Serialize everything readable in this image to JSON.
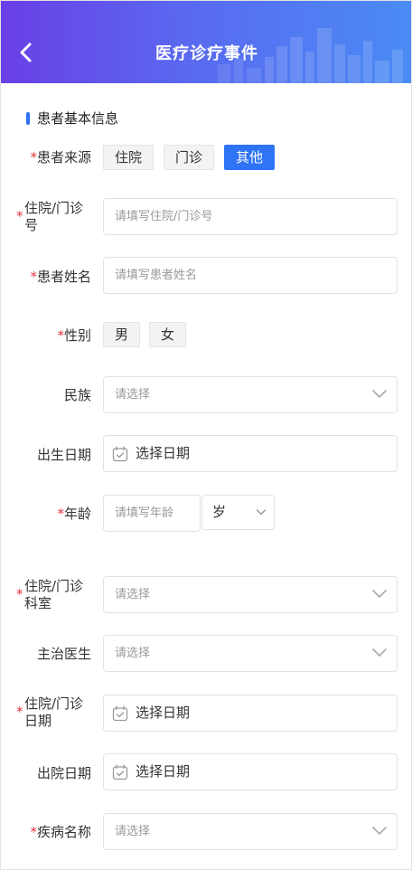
{
  "header": {
    "title": "医疗诊疗事件",
    "back_icon": "chevron-left-icon"
  },
  "section": {
    "title": "患者基本信息"
  },
  "colors": {
    "accent": "#2f73f6",
    "required": "#e0363f",
    "header_start": "#6a3fe6",
    "header_end": "#4a8cf5"
  },
  "form": {
    "source": {
      "label": "患者来源",
      "options": [
        "住院",
        "门诊",
        "其他"
      ],
      "selected": "其他"
    },
    "record_no": {
      "label": "住院/门诊号",
      "placeholder": "请填写住院/门诊号"
    },
    "name": {
      "label": "患者姓名",
      "placeholder": "请填写患者姓名"
    },
    "gender": {
      "label": "性别",
      "options": [
        "男",
        "女"
      ]
    },
    "ethnicity": {
      "label": "民族",
      "placeholder": "请选择"
    },
    "birth_date": {
      "label": "出生日期",
      "value": "选择日期"
    },
    "age": {
      "label": "年龄",
      "placeholder": "请填写年龄",
      "unit": "岁"
    },
    "department": {
      "label": "住院/门诊科室",
      "placeholder": "请选择"
    },
    "doctor": {
      "label": "主治医生",
      "placeholder": "请选择"
    },
    "admission_date": {
      "label": "住院/门诊日期",
      "value": "选择日期"
    },
    "discharge_date": {
      "label": "出院日期",
      "value": "选择日期"
    },
    "disease": {
      "label": "疾病名称",
      "placeholder": "请选择"
    }
  },
  "required_mark": "*"
}
